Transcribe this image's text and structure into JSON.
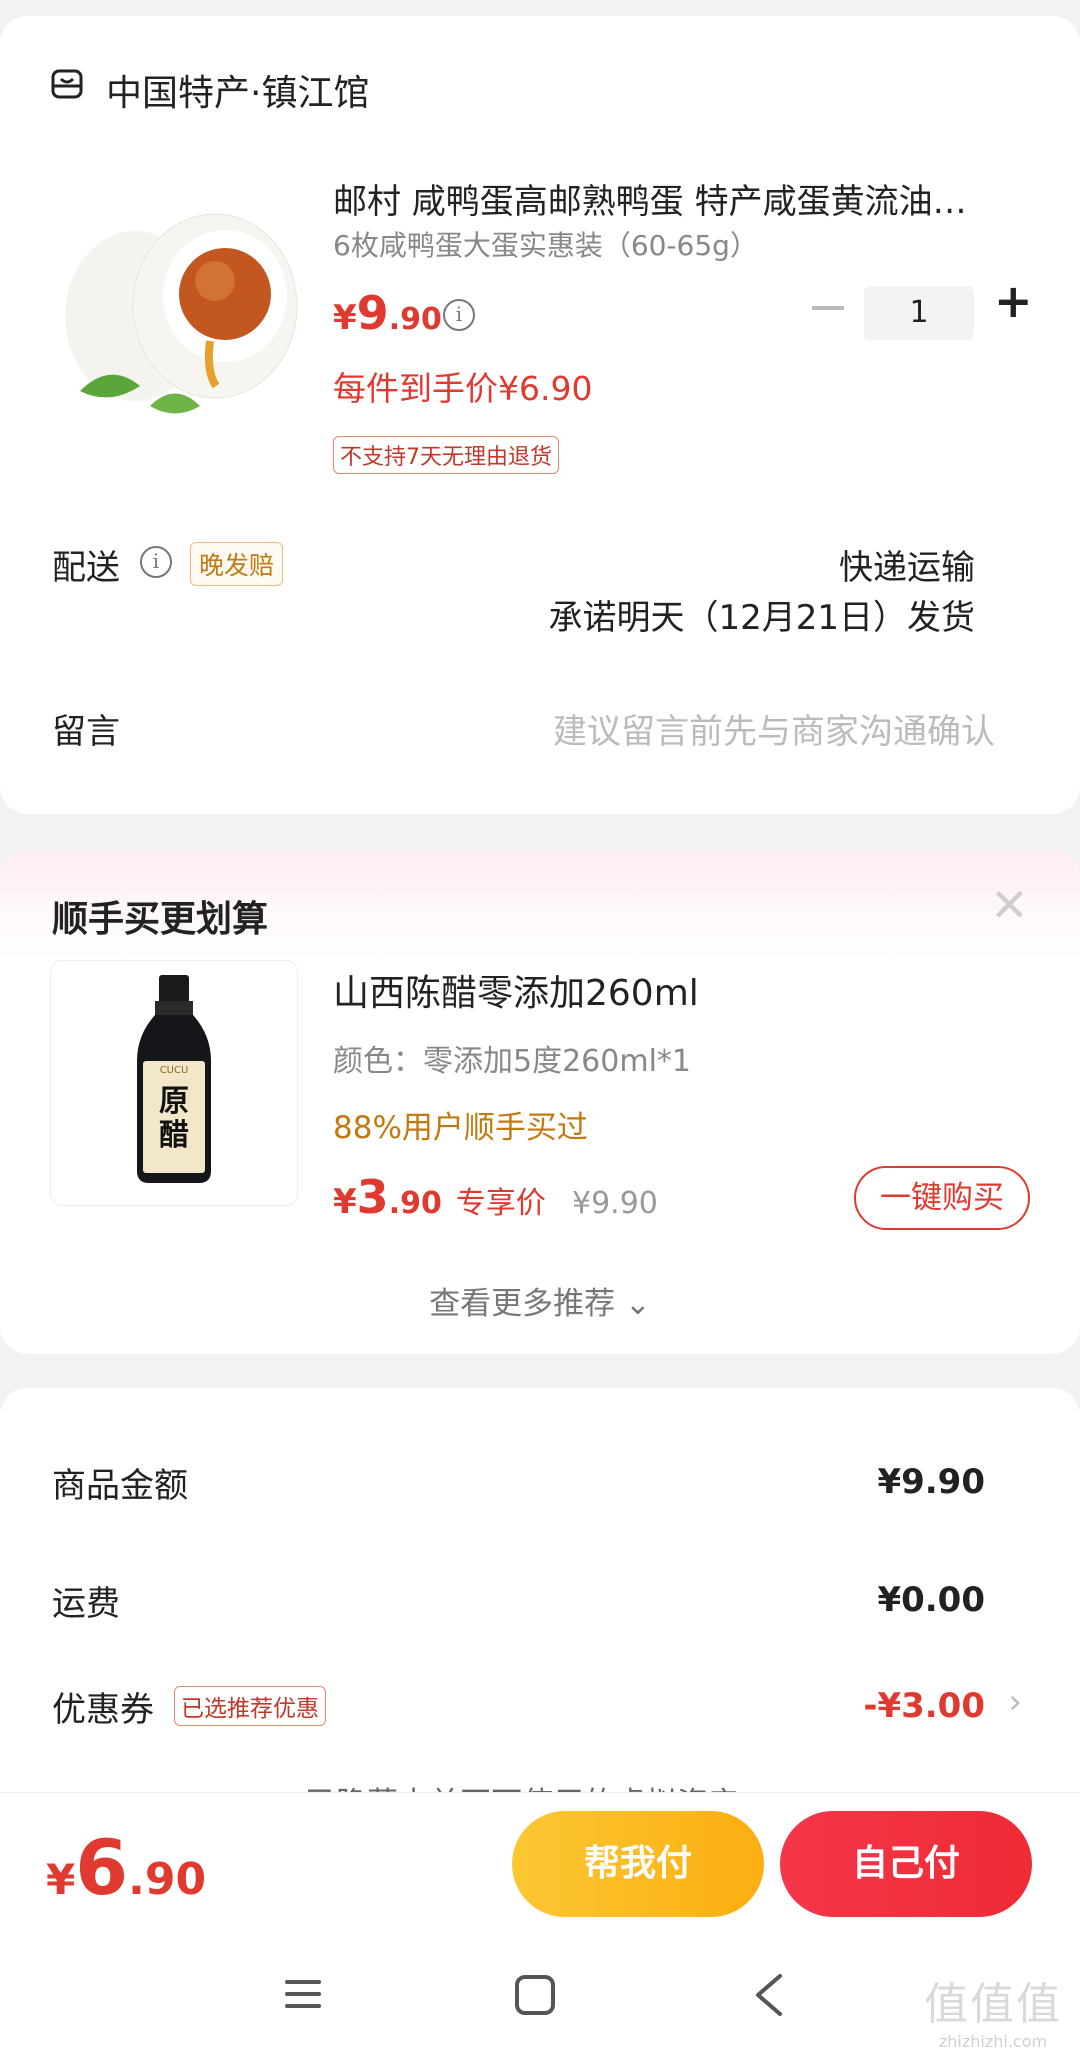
{
  "store": {
    "name": "中国特产·镇江馆",
    "icon": "store-icon"
  },
  "product": {
    "title": "邮村 咸鸭蛋高邮熟鸭蛋 特产咸蛋黄流油…",
    "spec": "6枚咸鸭蛋大蛋实惠装（60-65g）",
    "price_symbol": "¥",
    "price_int": "9",
    "price_dec": ".90",
    "final_price": "每件到手价¥6.90",
    "no_refund_tag": "不支持7天无理由退货",
    "quantity": "1"
  },
  "delivery": {
    "label": "配送",
    "late_tag": "晚发赔",
    "method": "快递运输",
    "promise": "承诺明天（12月21日）发货"
  },
  "message": {
    "label": "留言",
    "placeholder": "建议留言前先与商家沟通确认"
  },
  "recommend": {
    "title": "顺手买更划算",
    "name": "山西陈醋零添加260ml",
    "spec": "颜色：零添加5度260ml*1",
    "social": "88%用户顺手买过",
    "price_symbol": "¥",
    "price_int": "3",
    "price_dec": ".90",
    "price_label": "专享价",
    "original_price": "¥9.90",
    "buy_button": "一键购买",
    "more": "查看更多推荐 ⌄",
    "bottle_label": "原醋",
    "bottle_brand": "CUCU"
  },
  "summary": {
    "goods_label": "商品金额",
    "goods_value": "¥9.90",
    "shipping_label": "运费",
    "shipping_value": "¥0.00",
    "coupon_label": "优惠券",
    "coupon_tag": "已选推荐优惠",
    "coupon_value": "-¥3.00",
    "hidden_assets": "已隐藏本单不可使用的虚拟资产 ⌄"
  },
  "bottom": {
    "total_symbol": "¥",
    "total_int": "6",
    "total_dec": ".90",
    "help_pay": "帮我付",
    "self_pay": "自己付"
  },
  "watermark": {
    "text": "值值值",
    "site": "zhizhizhi.com"
  },
  "colors": {
    "accent_red": "#e0392f",
    "accent_orange": "#c27a10",
    "help_pay": "#fbb81f",
    "self_pay": "#f1303f"
  }
}
